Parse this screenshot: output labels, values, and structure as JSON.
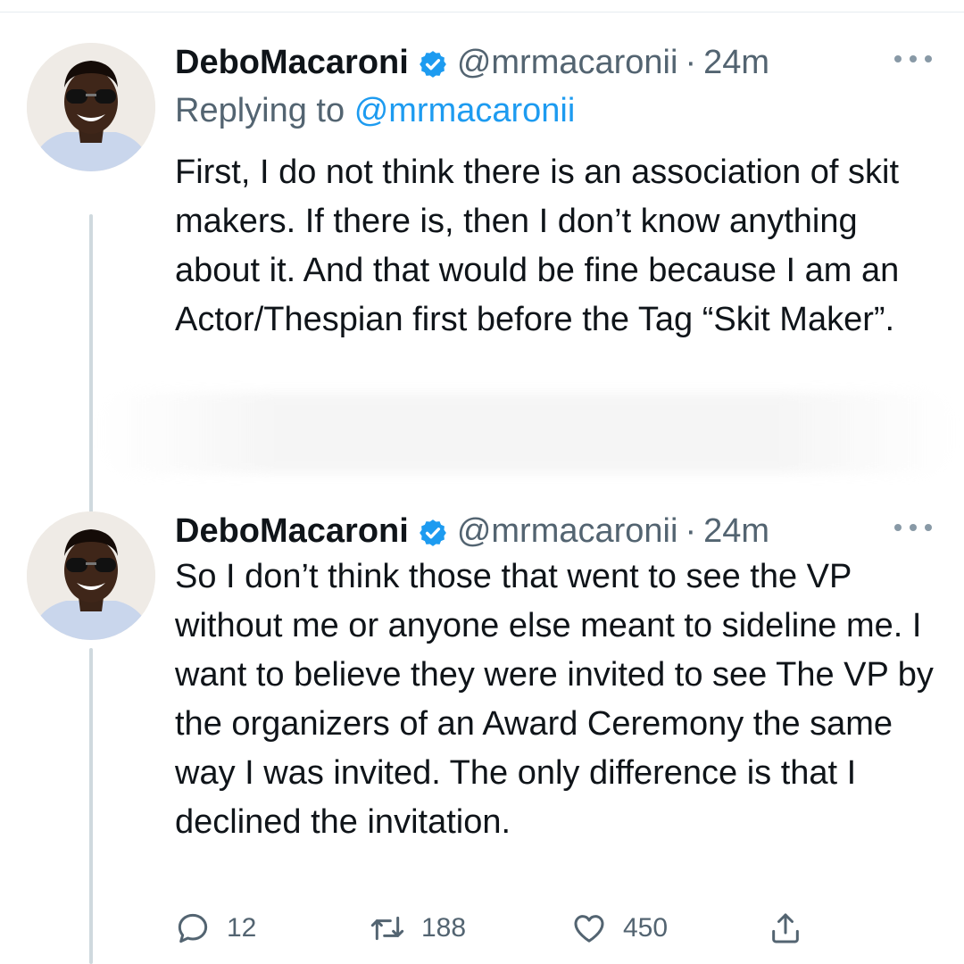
{
  "tweets": [
    {
      "display_name": "DeboMacaroni",
      "handle": "@mrmacaronii",
      "separator": "·",
      "time": "24m",
      "replying_prefix": "Replying to",
      "replying_mention": "@mrmacaronii",
      "text": "First, I do not think there is an association of skit makers. If there is, then I don’t know anything about it. And that would be fine because I am an Actor/Thespian first before the Tag “Skit Maker”."
    },
    {
      "display_name": "DeboMacaroni",
      "handle": "@mrmacaronii",
      "separator": "·",
      "time": "24m",
      "text": "So I don’t think those that went to see the VP without me or anyone else meant to sideline me. I want to believe they were invited to see The VP by the organizers of an Award Ceremony the same way I was invited. The only difference is that I declined the invitation.",
      "counts": {
        "replies": "12",
        "retweets": "188",
        "likes": "450"
      }
    }
  ],
  "icons": {
    "verified": "verified-badge-icon",
    "more": "more-options-icon",
    "reply": "reply-icon",
    "retweet": "retweet-icon",
    "like": "heart-icon",
    "share": "share-icon"
  },
  "colors": {
    "text": "#0f1419",
    "secondary": "#536471",
    "link": "#1d9bf0",
    "thread_line": "#cfd9de"
  }
}
